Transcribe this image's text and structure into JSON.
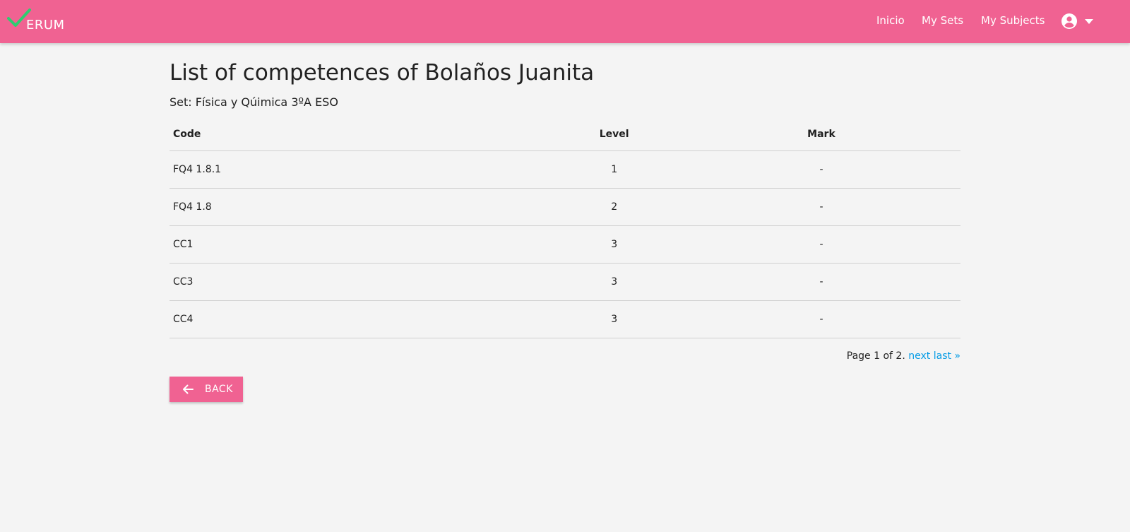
{
  "nav": {
    "logo_text": "ERUM",
    "links": [
      {
        "label": "Inicio"
      },
      {
        "label": "My Sets"
      },
      {
        "label": "My Subjects"
      }
    ],
    "account_icon": "account-circle-icon",
    "dropdown_icon": "caret-down-icon"
  },
  "page": {
    "title": "List of competences of Bolaños Juanita",
    "subtitle": "Set: Física y Qúimica 3ºA ESO"
  },
  "table": {
    "headers": {
      "code": "Code",
      "level": "Level",
      "mark": "Mark"
    },
    "rows": [
      {
        "code": "FQ4 1.8.1",
        "level": "1",
        "mark": "-"
      },
      {
        "code": "FQ4 1.8",
        "level": "2",
        "mark": "-"
      },
      {
        "code": "CC1",
        "level": "3",
        "mark": "-"
      },
      {
        "code": "CC3",
        "level": "3",
        "mark": "-"
      },
      {
        "code": "CC4",
        "level": "3",
        "mark": "-"
      }
    ]
  },
  "pagination": {
    "text": "Page 1 of 2.",
    "next": "next",
    "last": "last »"
  },
  "back_button": {
    "label": "BACK",
    "icon": "arrow-left-icon"
  },
  "colors": {
    "primary": "#f06292",
    "logo_check": "#2ecc71",
    "link": "#039be5",
    "background": "#f4f4f4"
  }
}
